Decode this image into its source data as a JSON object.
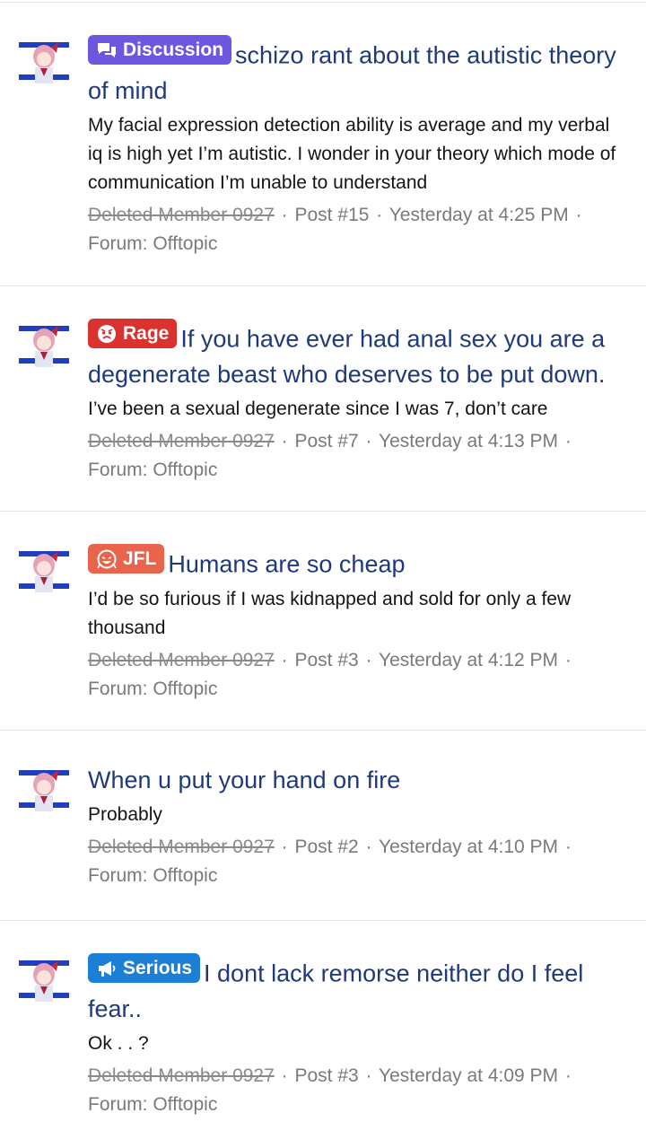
{
  "results": [
    {
      "prefix": {
        "label": "Discussion",
        "color": "#6b57e0",
        "icon": "comments-icon"
      },
      "title": "schizo rant about the autistic theory of mind",
      "snippet": "My facial expression detection ability is average and my verbal iq is high yet I’m autistic. I wonder in your theory which mode of communication I’m unable to understand",
      "user": "Deleted Member 0927",
      "post": "Post #15",
      "time": "Yesterday at 4:25 PM",
      "forum": "Forum: Offtopic"
    },
    {
      "prefix": {
        "label": "Rage",
        "color": "#d9322f",
        "icon": "angry-face-icon"
      },
      "title": "If you have ever had anal sex you are a degenerate beast who deserves to be put down.",
      "snippet": "I’ve been a sexual degenerate since I was 7, don’t care",
      "user": "Deleted Member 0927",
      "post": "Post #7",
      "time": "Yesterday at 4:13 PM",
      "forum": "Forum: Offtopic"
    },
    {
      "prefix": {
        "label": "JFL",
        "color": "#e8644c",
        "icon": "laughing-face-icon"
      },
      "title": "Humans are so cheap",
      "snippet": "I’d be so furious if I was kidnapped and sold for only a few thousand",
      "user": "Deleted Member 0927",
      "post": "Post #3",
      "time": "Yesterday at 4:12 PM",
      "forum": "Forum: Offtopic"
    },
    {
      "prefix": null,
      "title": "When u put your hand on fire",
      "snippet": "Probably",
      "user": "Deleted Member 0927",
      "post": "Post #2",
      "time": "Yesterday at 4:10 PM",
      "forum": "Forum: Offtopic"
    },
    {
      "prefix": {
        "label": "Serious",
        "color": "#1c7fd6",
        "icon": "megaphone-icon"
      },
      "title": "I dont lack remorse neither do I feel fear..",
      "snippet": "Ok . . ?",
      "user": "Deleted Member 0927",
      "post": "Post #3",
      "time": "Yesterday at 4:09 PM",
      "forum": "Forum: Offtopic"
    }
  ],
  "separator": "·"
}
